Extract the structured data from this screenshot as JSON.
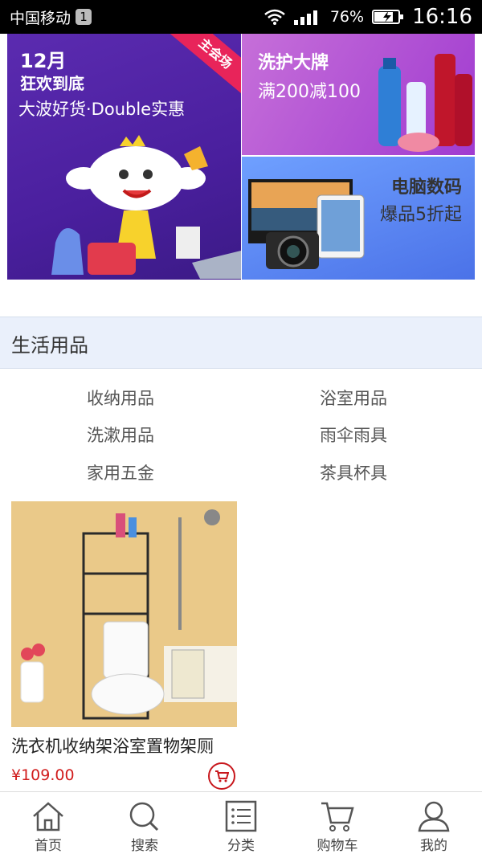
{
  "status": {
    "carrier": "中国移动",
    "notif_count": "1",
    "battery": "76%",
    "time": "16:16"
  },
  "banner": {
    "main_date": "12月",
    "main_line2": "狂欢到底",
    "main_tag": "主会场",
    "main_sub": "大波好货·Double实惠",
    "tr_title": "洗护大牌",
    "tr_sub": "满200减100",
    "br_title": "电脑数码",
    "br_sub": "爆品5折起"
  },
  "section": {
    "title": "生活用品",
    "categories": [
      "收纳用品",
      "浴室用品",
      "洗漱用品",
      "雨伞雨具",
      "家用五金",
      "茶具杯具"
    ]
  },
  "products": [
    {
      "name": "洗衣机收纳架浴室置物架厕",
      "price": "¥109.00"
    }
  ],
  "tabbar": {
    "items": [
      {
        "label": "首页",
        "icon": "home-icon"
      },
      {
        "label": "搜索",
        "icon": "search-icon"
      },
      {
        "label": "分类",
        "icon": "list-icon"
      },
      {
        "label": "购物车",
        "icon": "cart-icon"
      },
      {
        "label": "我的",
        "icon": "user-icon"
      }
    ]
  },
  "colors": {
    "price": "#d11c1c",
    "section_bg": "#eaf0fb",
    "statusbar": "#000000"
  }
}
